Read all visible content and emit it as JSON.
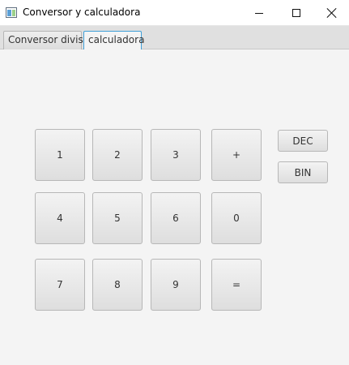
{
  "window": {
    "title": "Conversor y calculadora",
    "controls": {
      "minimize_icon": "minimize-icon",
      "maximize_icon": "maximize-icon",
      "close_icon": "close-icon"
    }
  },
  "tabs": [
    {
      "label": "Conversor divisa",
      "selected": false
    },
    {
      "label": "calculadora",
      "selected": true
    }
  ],
  "calculator": {
    "keys": {
      "k1": "1",
      "k2": "2",
      "k3": "3",
      "plus": "+",
      "k4": "4",
      "k5": "5",
      "k6": "6",
      "k0": "0",
      "k7": "7",
      "k8": "8",
      "k9": "9",
      "equals": "="
    },
    "side": {
      "dec": "DEC",
      "bin": "BIN"
    }
  },
  "colors": {
    "selected_tab_border": "#3f9fd8",
    "background": "#f4f4f4"
  }
}
